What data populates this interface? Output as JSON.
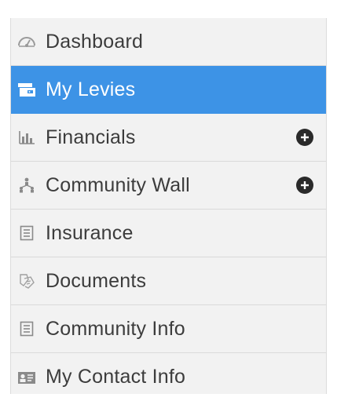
{
  "menu": {
    "items": [
      {
        "label": "Dashboard",
        "icon": "dashboard-gauge-icon",
        "active": false
      },
      {
        "label": "My Levies",
        "icon": "wallet-icon",
        "active": true
      },
      {
        "label": "Financials",
        "icon": "bar-chart-icon",
        "active": false,
        "expandable": true
      },
      {
        "label": "Community Wall",
        "icon": "people-network-icon",
        "active": false,
        "expandable": true
      },
      {
        "label": "Insurance",
        "icon": "document-lines-icon",
        "active": false
      },
      {
        "label": "Documents",
        "icon": "documents-icon",
        "active": false
      },
      {
        "label": "Community Info",
        "icon": "document-lines-icon",
        "active": false
      },
      {
        "label": "My Contact Info",
        "icon": "contact-card-icon",
        "active": false
      }
    ]
  },
  "colors": {
    "active_background": "#3d93e6",
    "menu_background": "#f2f2f2",
    "text": "#3c3c3c",
    "expand_button": "#2a2a2a"
  }
}
